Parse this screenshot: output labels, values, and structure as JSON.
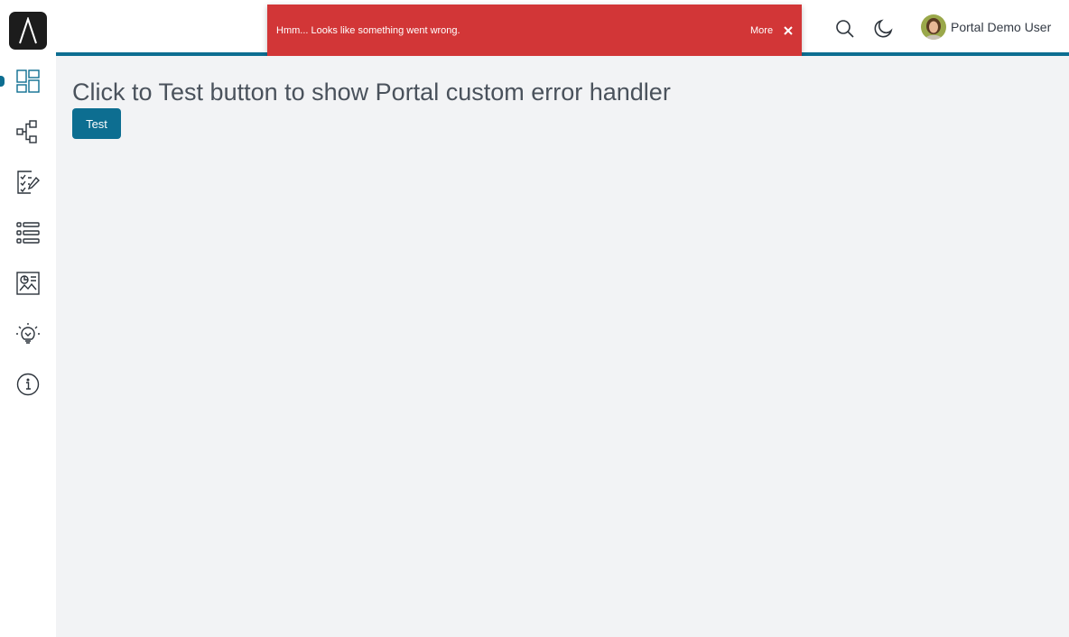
{
  "header": {
    "user_name": "Portal Demo User",
    "icons": [
      "search-icon",
      "moon-icon",
      "avatar"
    ]
  },
  "toast": {
    "message": "Hmm... Looks like something went wrong.",
    "more_label": "More",
    "close_icon": "close-icon",
    "background": "#d23637"
  },
  "sidebar": {
    "items": [
      {
        "icon": "dashboard-icon",
        "active": true
      },
      {
        "icon": "workflow-icon",
        "active": false
      },
      {
        "icon": "tasks-icon",
        "active": false
      },
      {
        "icon": "list-icon",
        "active": false
      },
      {
        "icon": "report-icon",
        "active": false
      },
      {
        "icon": "lightbulb-icon",
        "active": false
      },
      {
        "icon": "info-icon",
        "active": false
      }
    ]
  },
  "main": {
    "title": "Click to Test button to show Portal custom error handler",
    "test_button_label": "Test"
  },
  "colors": {
    "accent": "#0d6e91",
    "error": "#d23637",
    "content_bg": "#f2f3f5"
  }
}
